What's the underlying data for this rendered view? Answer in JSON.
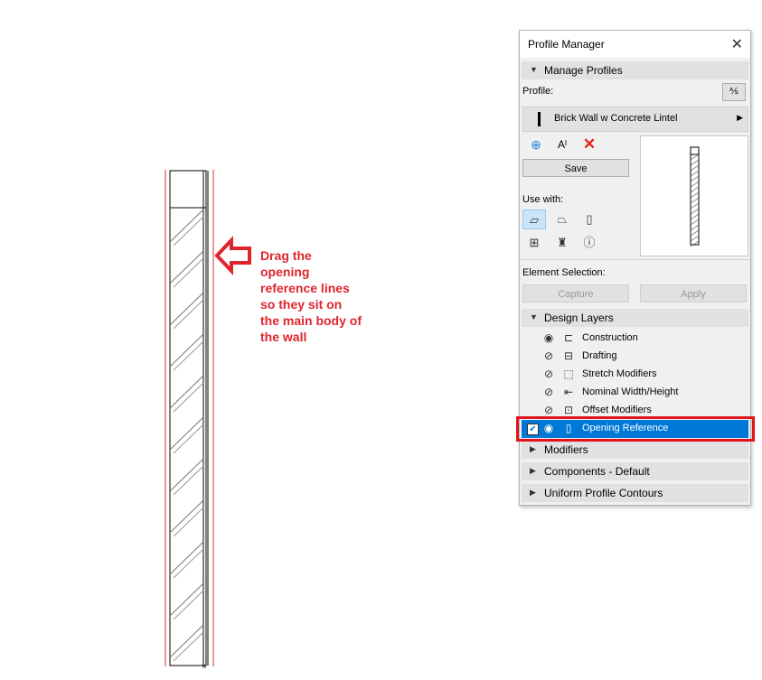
{
  "callout": {
    "lines": [
      "Drag the",
      "opening",
      "reference lines",
      "so they sit on",
      "the main body of",
      "the wall"
    ],
    "color": "#e0242d"
  },
  "palette": {
    "title": "Profile Manager",
    "close_icon": "close-icon",
    "manage_profiles": {
      "label": "Manage Profiles"
    },
    "profile_label": "Profile:",
    "profile_name": "Brick Wall w Concrete Lintel",
    "save_label": "Save",
    "use_with_label": "Use with:",
    "element_selection_label": "Element Selection:",
    "capture_label": "Capture",
    "apply_label": "Apply",
    "design_layers": {
      "label": "Design Layers",
      "items": [
        {
          "name": "Construction",
          "icon": "construction-icon"
        },
        {
          "name": "Drafting",
          "icon": "drafting-icon"
        },
        {
          "name": "Stretch Modifiers",
          "icon": "stretch-icon"
        },
        {
          "name": "Nominal Width/Height",
          "icon": "nominal-icon"
        },
        {
          "name": "Offset Modifiers",
          "icon": "offset-icon"
        },
        {
          "name": "Opening Reference",
          "icon": "opening-ref-icon",
          "selected": true
        }
      ]
    },
    "sections": [
      {
        "label": "Modifiers"
      },
      {
        "label": "Components - Default"
      },
      {
        "label": "Uniform Profile Contours"
      }
    ],
    "selection_color": "#0078d7",
    "highlight_color": "#e0141e"
  }
}
